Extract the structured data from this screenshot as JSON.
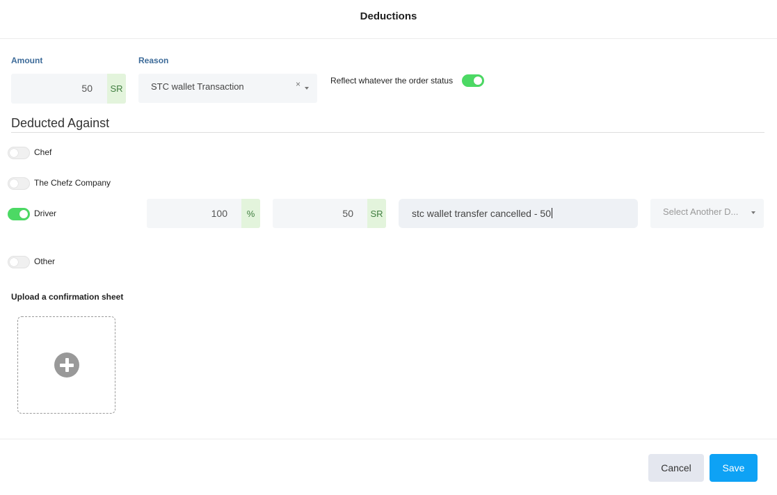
{
  "dialog": {
    "title": "Deductions"
  },
  "amount": {
    "label": "Amount",
    "value": "50",
    "unit": "SR"
  },
  "reason": {
    "label": "Reason",
    "value": "STC wallet Transaction",
    "clear": "×"
  },
  "reflect": {
    "label": "Reflect whatever the order status",
    "on": true
  },
  "deducted_against": {
    "title": "Deducted Against",
    "options": [
      {
        "label": "Chef",
        "on": false
      },
      {
        "label": "The Chefz Company",
        "on": false
      },
      {
        "label": "Driver",
        "on": true
      },
      {
        "label": "Other",
        "on": false
      }
    ],
    "driver": {
      "percent_value": "100",
      "percent_unit": "%",
      "amount_value": "50",
      "amount_unit": "SR",
      "note": "stc wallet transfer cancelled - 50",
      "select_placeholder": "Select Another D..."
    }
  },
  "upload": {
    "label": "Upload a confirmation sheet",
    "icon": "plus-circle-icon"
  },
  "footer": {
    "cancel_label": "Cancel",
    "save_label": "Save"
  },
  "colors": {
    "toggle_on": "#4cd964",
    "primary": "#0ea2f5",
    "label_blue": "#3d6b99",
    "addon_green": "#e3f4dc"
  }
}
